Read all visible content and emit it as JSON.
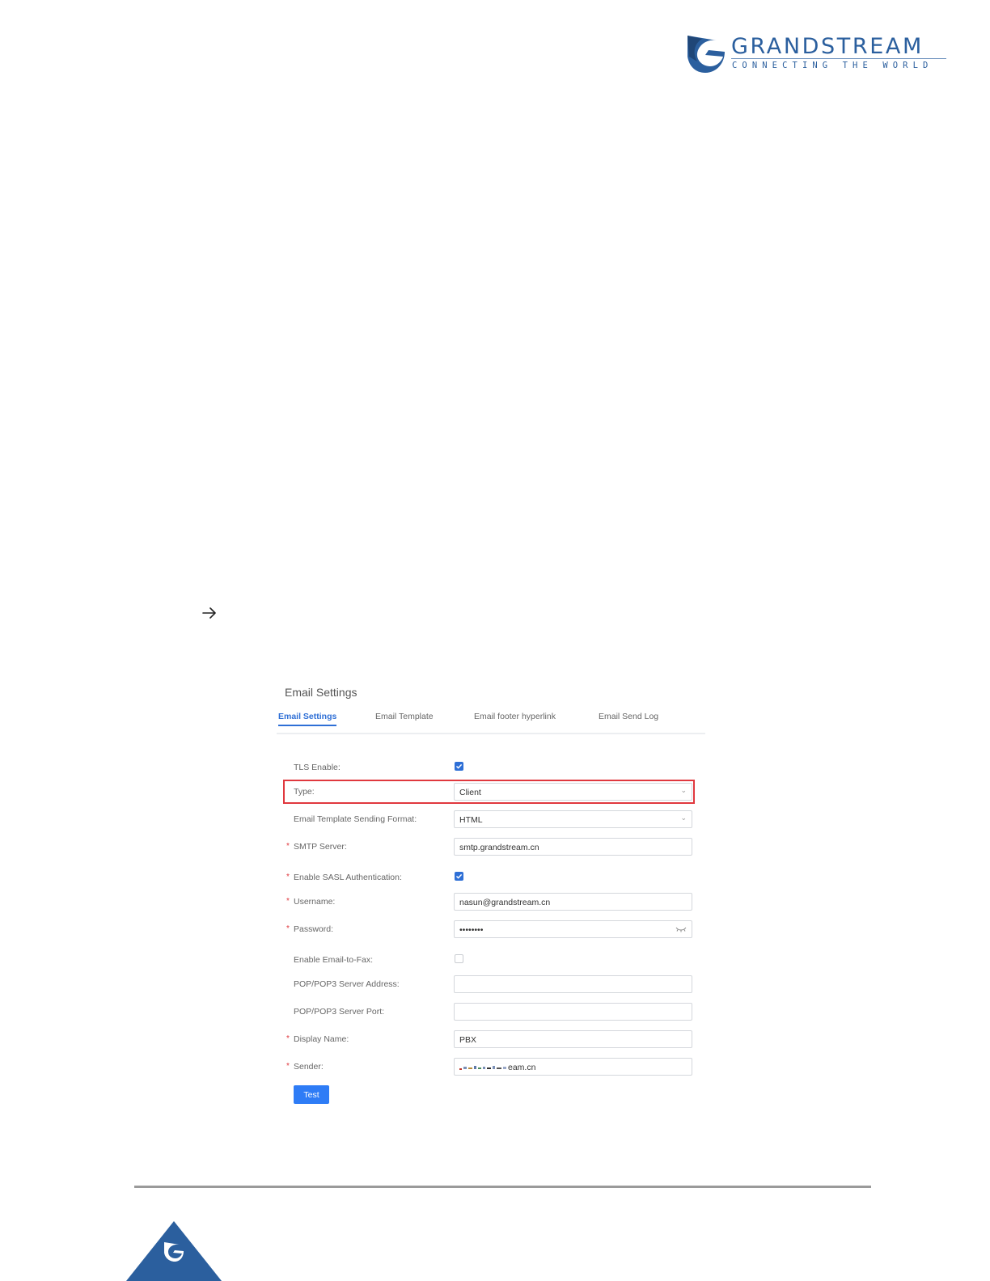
{
  "header": {
    "brand_name": "GRANDSTREAM",
    "brand_tagline": "CONNECTING THE WORLD",
    "brand_color": "#2b5f9e"
  },
  "marker": {
    "icon": "right-arrow-icon"
  },
  "screenshot": {
    "title": "Email Settings",
    "tabs": [
      {
        "label": "Email Settings",
        "active": true
      },
      {
        "label": "Email Template",
        "active": false
      },
      {
        "label": "Email footer hyperlink",
        "active": false
      },
      {
        "label": "Email Send Log",
        "active": false
      }
    ],
    "fields": {
      "tls_enable": {
        "label": "TLS Enable:",
        "checked": true
      },
      "type": {
        "label": "Type:",
        "value": "Client"
      },
      "sending_format": {
        "label": "Email Template Sending Format:",
        "value": "HTML"
      },
      "smtp_server": {
        "label": "SMTP Server:",
        "value": "smtp.grandstream.cn",
        "required": true
      },
      "sasl": {
        "label": "Enable SASL Authentication:",
        "checked": true,
        "required": true
      },
      "username": {
        "label": "Username:",
        "value": "nasun@grandstream.cn",
        "required": true
      },
      "password": {
        "label": "Password:",
        "value": "••••••••",
        "required": true
      },
      "email_to_fax": {
        "label": "Enable Email-to-Fax:",
        "checked": false
      },
      "pop_address": {
        "label": "POP/POP3 Server Address:",
        "value": ""
      },
      "pop_port": {
        "label": "POP/POP3 Server Port:",
        "value": ""
      },
      "display_name": {
        "label": "Display Name:",
        "value": "PBX",
        "required": true
      },
      "sender": {
        "label": "Sender:",
        "value_suffix": "eam.cn",
        "required": true
      }
    },
    "required_mark": "*",
    "test_button": "Test",
    "highlight_color": "#e0383e",
    "accent_color": "#2e6fd6"
  }
}
